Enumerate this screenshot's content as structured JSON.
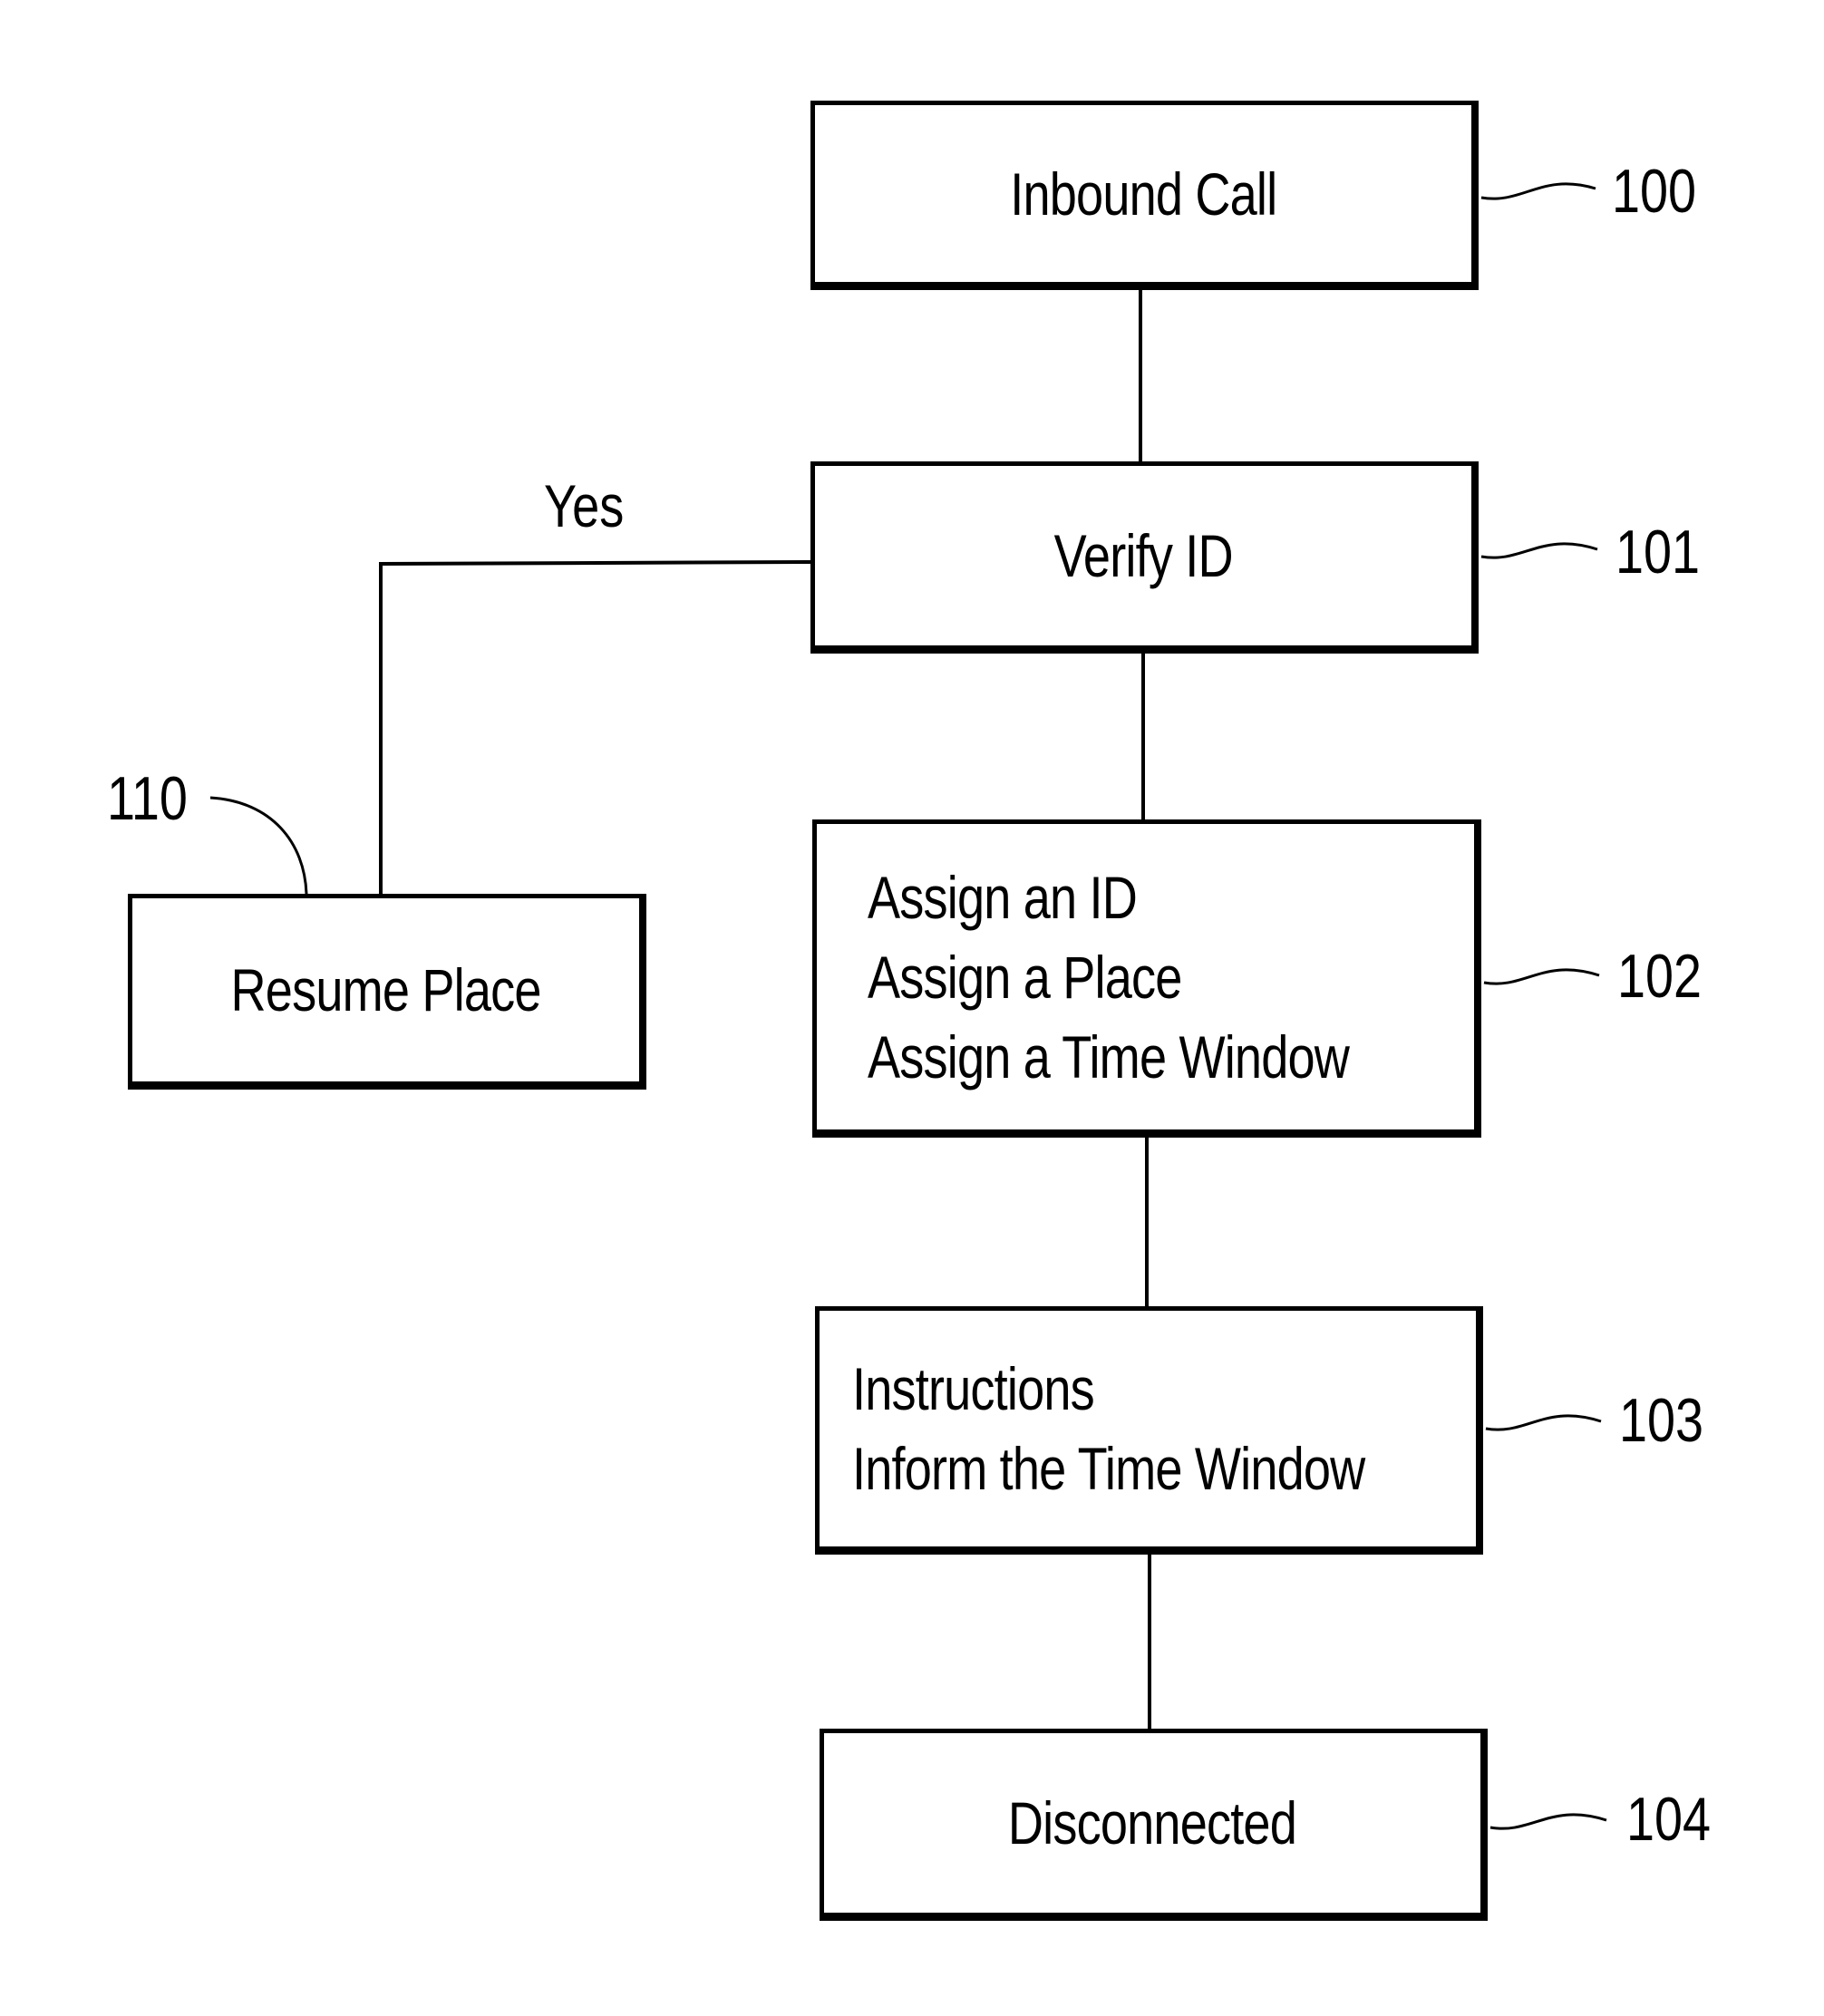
{
  "diagram": {
    "type": "flowchart",
    "nodes": [
      {
        "id": "100",
        "label": "Inbound Call",
        "ref": "100"
      },
      {
        "id": "101",
        "label": "Verify ID",
        "ref": "101"
      },
      {
        "id": "102",
        "lines": [
          "Assign an ID",
          "Assign a Place",
          "Assign a Time Window"
        ],
        "ref": "102"
      },
      {
        "id": "103",
        "lines": [
          "Instructions",
          "Inform the Time Window"
        ],
        "ref": "103"
      },
      {
        "id": "104",
        "label": "Disconnected",
        "ref": "104"
      },
      {
        "id": "110",
        "label": "Resume Place",
        "ref": "110"
      }
    ],
    "edges": [
      {
        "from": "100",
        "to": "101",
        "label": ""
      },
      {
        "from": "101",
        "to": "102",
        "label": ""
      },
      {
        "from": "102",
        "to": "103",
        "label": ""
      },
      {
        "from": "103",
        "to": "104",
        "label": ""
      },
      {
        "from": "101",
        "to": "110",
        "label": "Yes"
      }
    ],
    "yes_label": "Yes"
  }
}
